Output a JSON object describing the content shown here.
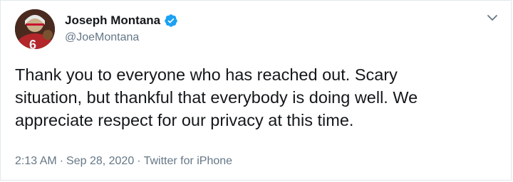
{
  "author": {
    "name": "Joseph Montana",
    "handle": "@JoeMontana",
    "verified": true,
    "avatar": "profile-photo"
  },
  "tweet": {
    "lines": [
      "Thank you to everyone who has reached out. Scary",
      "situation, but thankful that everybody is doing well. We",
      "appreciate respect for our privacy at this time."
    ]
  },
  "meta": {
    "time": "2:13 AM",
    "date": "Sep 28, 2020",
    "source": "Twitter for iPhone",
    "separator": "·"
  },
  "icons": {
    "verified": "verified-badge-icon",
    "more": "chevron-down-icon"
  },
  "colors": {
    "accent": "#1da1f2",
    "text": "#14171a",
    "secondary": "#657786",
    "border": "#e1e8ed"
  }
}
